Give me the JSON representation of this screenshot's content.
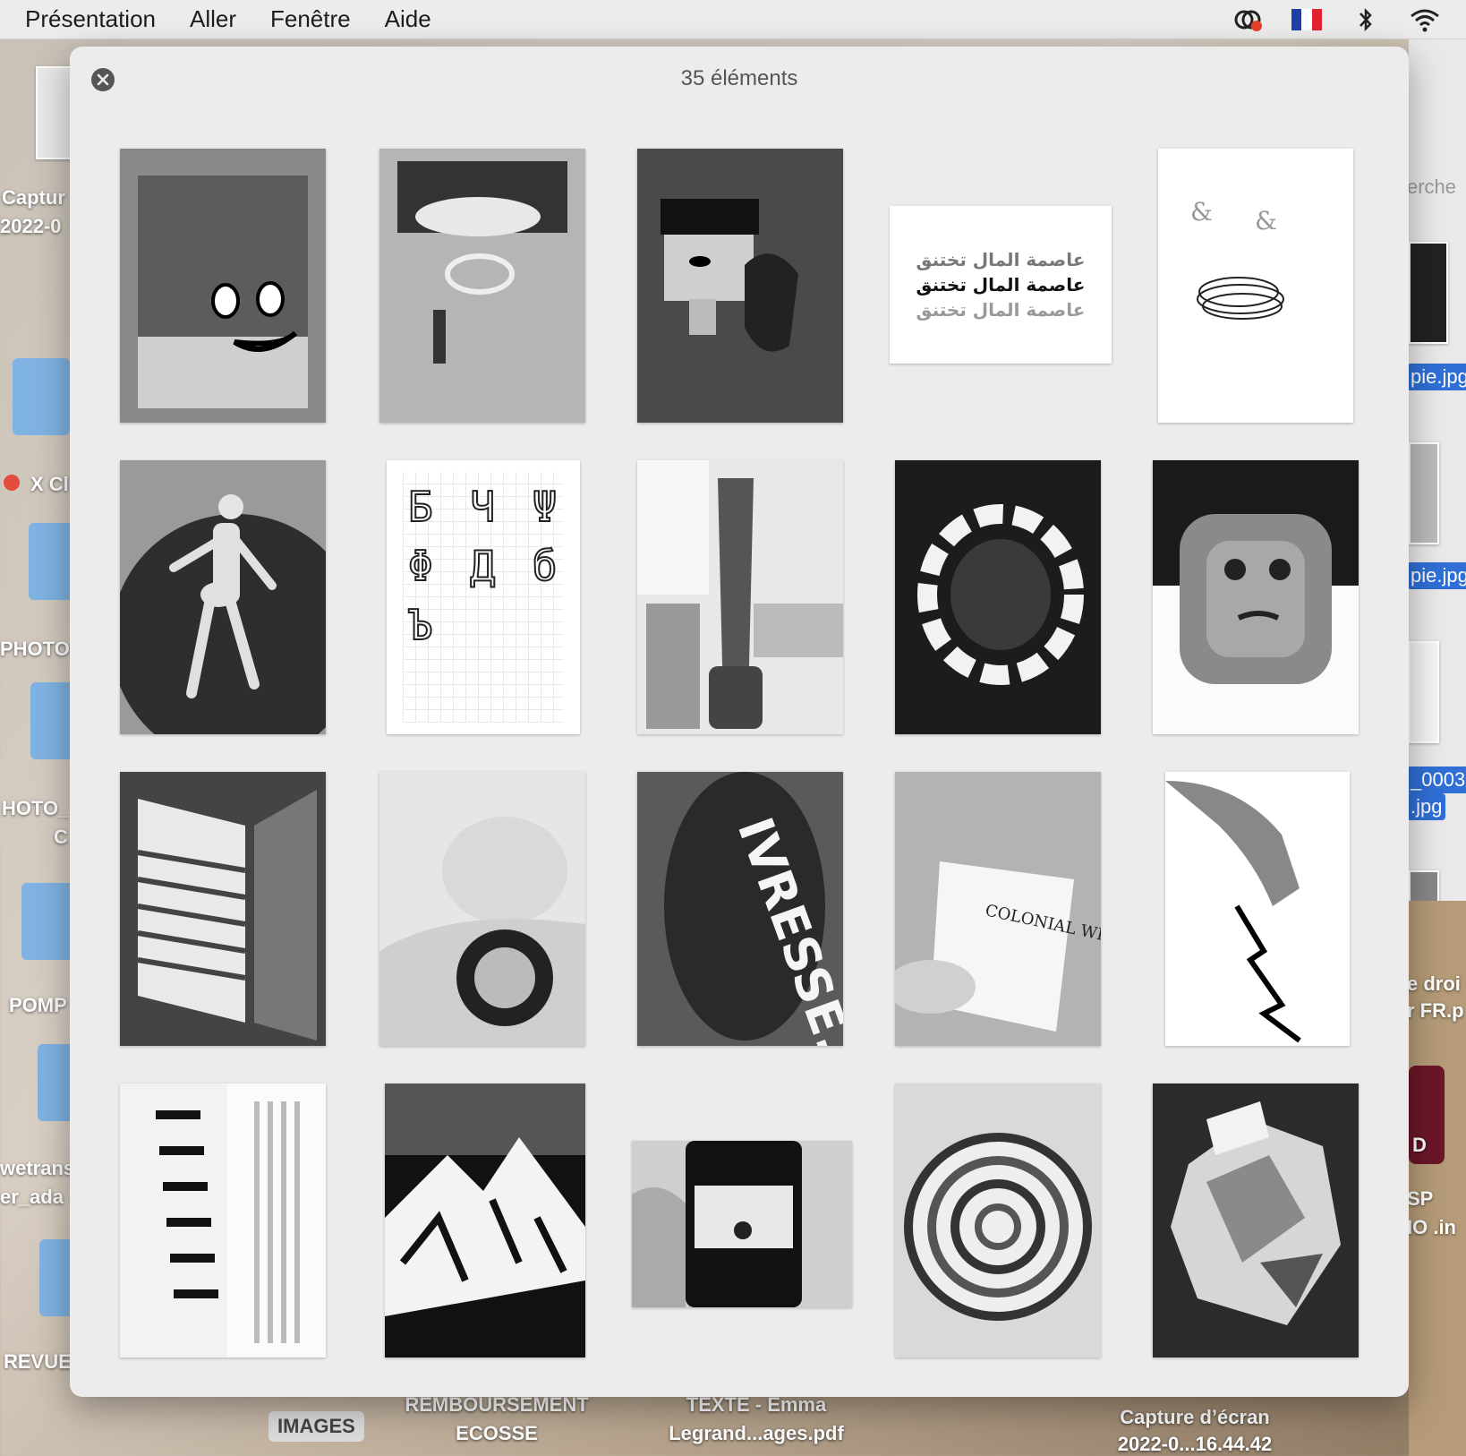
{
  "menubar": {
    "items": [
      "Présentation",
      "Aller",
      "Fenêtre",
      "Aide"
    ],
    "tray": [
      "creative-cloud-icon",
      "french-flag-icon",
      "bluetooth-icon",
      "wifi-icon"
    ]
  },
  "desktop": {
    "left_labels": [
      "Captur",
      "2022-0",
      "X Cl",
      "PHOTO",
      "HOTO_",
      "C",
      "POMP",
      "wetrans",
      "er_ada",
      "REVUE"
    ],
    "right_labels": [
      "erche",
      "pie.jpg",
      "pie.jpg",
      "_0003",
      ".jpg",
      "e droi",
      "r FR.p",
      "D",
      "SP",
      "IO .in"
    ],
    "bottom_labels": {
      "images": "IMAGES",
      "remboursement_1": "REMBOURSEMENT",
      "remboursement_2": "ECOSSE",
      "texte_1": "TEXTE - Emma",
      "texte_2": "Legrand...ages.pdf",
      "capture_1": "Capture d’écran",
      "capture_2": "2022-0...16.44.42"
    }
  },
  "quicklook": {
    "title": "35 éléments",
    "thumbnails": [
      {
        "name": "painting-smiling-face"
      },
      {
        "name": "painting-abstract-grey"
      },
      {
        "name": "painting-faces-dark"
      },
      {
        "name": "arabic-typography",
        "text": "عاصمة المال تختنق"
      },
      {
        "name": "ampersand-typography",
        "text": "&"
      },
      {
        "name": "stone-figure-photo"
      },
      {
        "name": "cyrillic-letters-grid",
        "text": "Б Ч Ψ Φ Д б Ъ"
      },
      {
        "name": "sculpture-column-studio"
      },
      {
        "name": "stone-circle-photo"
      },
      {
        "name": "stone-face-sculpture"
      },
      {
        "name": "window-shadow-photo"
      },
      {
        "name": "car-ice-cream-photo"
      },
      {
        "name": "ivresse-sign-photo",
        "text": "IVRESSE.."
      },
      {
        "name": "book-colonial-white",
        "text": "COLONIAL WHITE"
      },
      {
        "name": "hand-lightning-photo"
      },
      {
        "name": "book-page-dancers"
      },
      {
        "name": "mountain-car-graphic"
      },
      {
        "name": "phone-in-hand-photo"
      },
      {
        "name": "spiral-collage"
      },
      {
        "name": "paper-collage-pile"
      }
    ]
  }
}
